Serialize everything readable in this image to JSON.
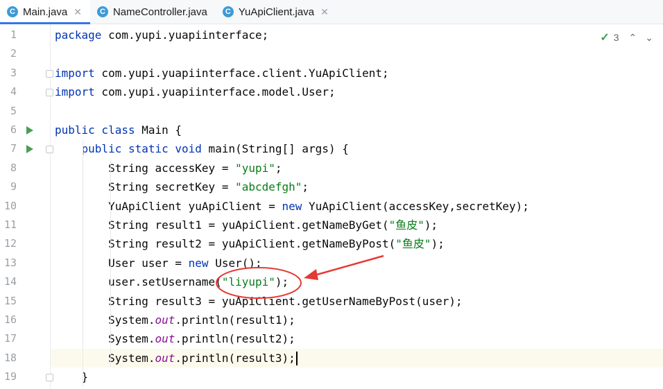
{
  "tabs": [
    {
      "label": "Main.java",
      "active": true,
      "icon": "java-class-icon"
    },
    {
      "label": "NameController.java",
      "active": false,
      "icon": "java-class-icon"
    },
    {
      "label": "YuApiClient.java",
      "active": false,
      "icon": "java-class-icon"
    }
  ],
  "status": {
    "problems_count": "3",
    "up": "⌃",
    "down": "⌄"
  },
  "lines": [
    {
      "n": "1",
      "tokens": [
        [
          "kw",
          "package"
        ],
        [
          "p",
          " com.yupi.yuapiinterface;"
        ]
      ]
    },
    {
      "n": "2",
      "tokens": []
    },
    {
      "n": "3",
      "tokens": [
        [
          "kw",
          "import"
        ],
        [
          "p",
          " com.yupi.yuapiinterface.client.YuApiClient;"
        ]
      ]
    },
    {
      "n": "4",
      "tokens": [
        [
          "kw",
          "import"
        ],
        [
          "p",
          " com.yupi.yuapiinterface.model.User;"
        ]
      ]
    },
    {
      "n": "5",
      "tokens": []
    },
    {
      "n": "6",
      "tokens": [
        [
          "kw",
          "public class"
        ],
        [
          "p",
          " Main {"
        ]
      ]
    },
    {
      "n": "7",
      "tokens": [
        [
          "p",
          "    "
        ],
        [
          "kw",
          "public static void"
        ],
        [
          "p",
          " main(String[] args) {"
        ]
      ]
    },
    {
      "n": "8",
      "tokens": [
        [
          "p",
          "        String accessKey = "
        ],
        [
          "str",
          "\"yupi\""
        ],
        [
          "p",
          ";"
        ]
      ]
    },
    {
      "n": "9",
      "tokens": [
        [
          "p",
          "        String secretKey = "
        ],
        [
          "str",
          "\"abcdefgh\""
        ],
        [
          "p",
          ";"
        ]
      ]
    },
    {
      "n": "10",
      "tokens": [
        [
          "p",
          "        YuApiClient yuApiClient = "
        ],
        [
          "kw",
          "new"
        ],
        [
          "p",
          " YuApiClient(accessKey,secretKey);"
        ]
      ]
    },
    {
      "n": "11",
      "tokens": [
        [
          "p",
          "        String result1 = yuApiClient.getNameByGet("
        ],
        [
          "str",
          "\"鱼皮\""
        ],
        [
          "p",
          ");"
        ]
      ]
    },
    {
      "n": "12",
      "tokens": [
        [
          "p",
          "        String result2 = yuApiClient.getNameByPost("
        ],
        [
          "str",
          "\"鱼皮\""
        ],
        [
          "p",
          ");"
        ]
      ]
    },
    {
      "n": "13",
      "tokens": [
        [
          "p",
          "        User user = "
        ],
        [
          "kw",
          "new"
        ],
        [
          "p",
          " User();"
        ]
      ]
    },
    {
      "n": "14",
      "tokens": [
        [
          "p",
          "        user.setUsername("
        ],
        [
          "str",
          "\"liyupi\""
        ],
        [
          "p",
          ");"
        ]
      ]
    },
    {
      "n": "15",
      "tokens": [
        [
          "p",
          "        String result3 = yuApiClient.getUserNameByPost(user);"
        ]
      ]
    },
    {
      "n": "16",
      "tokens": [
        [
          "p",
          "        System."
        ],
        [
          "fld",
          "out"
        ],
        [
          "p",
          ".println(result1);"
        ]
      ]
    },
    {
      "n": "17",
      "tokens": [
        [
          "p",
          "        System."
        ],
        [
          "fld",
          "out"
        ],
        [
          "p",
          ".println(result2);"
        ]
      ]
    },
    {
      "n": "18",
      "tokens": [
        [
          "p",
          "        System."
        ],
        [
          "fld",
          "out"
        ],
        [
          "p",
          ".println(result3);"
        ]
      ]
    },
    {
      "n": "19",
      "tokens": [
        [
          "p",
          "    }"
        ]
      ]
    }
  ],
  "colors": {
    "keyword": "#0033b3",
    "string": "#067d17",
    "field": "#871094",
    "annotation": "#e53935"
  }
}
